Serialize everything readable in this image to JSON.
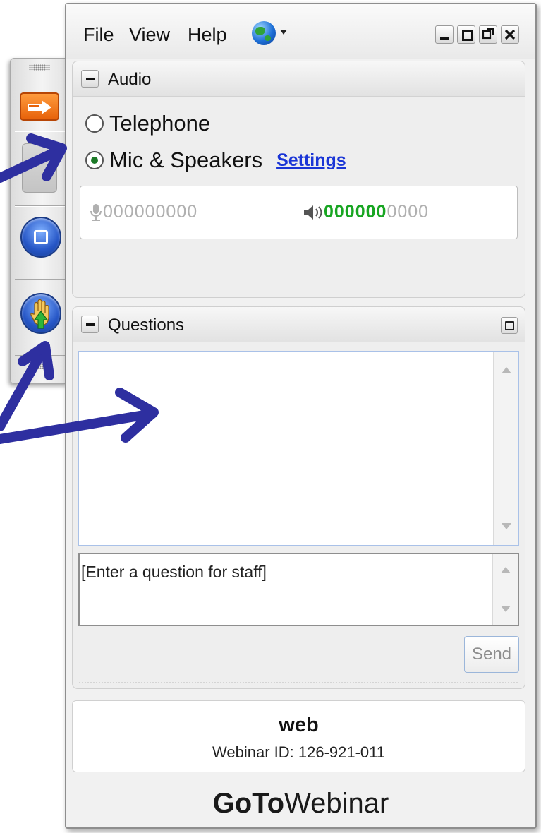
{
  "menubar": {
    "file": "File",
    "view": "View",
    "help": "Help",
    "globe_icon": "globe-icon"
  },
  "audio": {
    "title": "Audio",
    "telephone_label": "Telephone",
    "mic_label": "Mic & Speakers",
    "selected": "mic",
    "settings_link": "Settings",
    "mic_level_dots": "000000000",
    "speaker_level_on": "000000",
    "speaker_level_off": "0000",
    "speaker_level_fraction": 0.6
  },
  "questions": {
    "title": "Questions",
    "input_placeholder": "[Enter a question for staff]",
    "send_label": "Send"
  },
  "webinar": {
    "name": "web",
    "id_label": "Webinar ID: 126-921-011"
  },
  "brand": {
    "goto": "GoTo",
    "webinar": "Webinar"
  },
  "colors": {
    "accent_orange": "#e7620a",
    "button_blue": "#2656c6",
    "level_green": "#18a522",
    "link_blue": "#1a35d6",
    "annotation_arrow": "#2e2fa0"
  }
}
